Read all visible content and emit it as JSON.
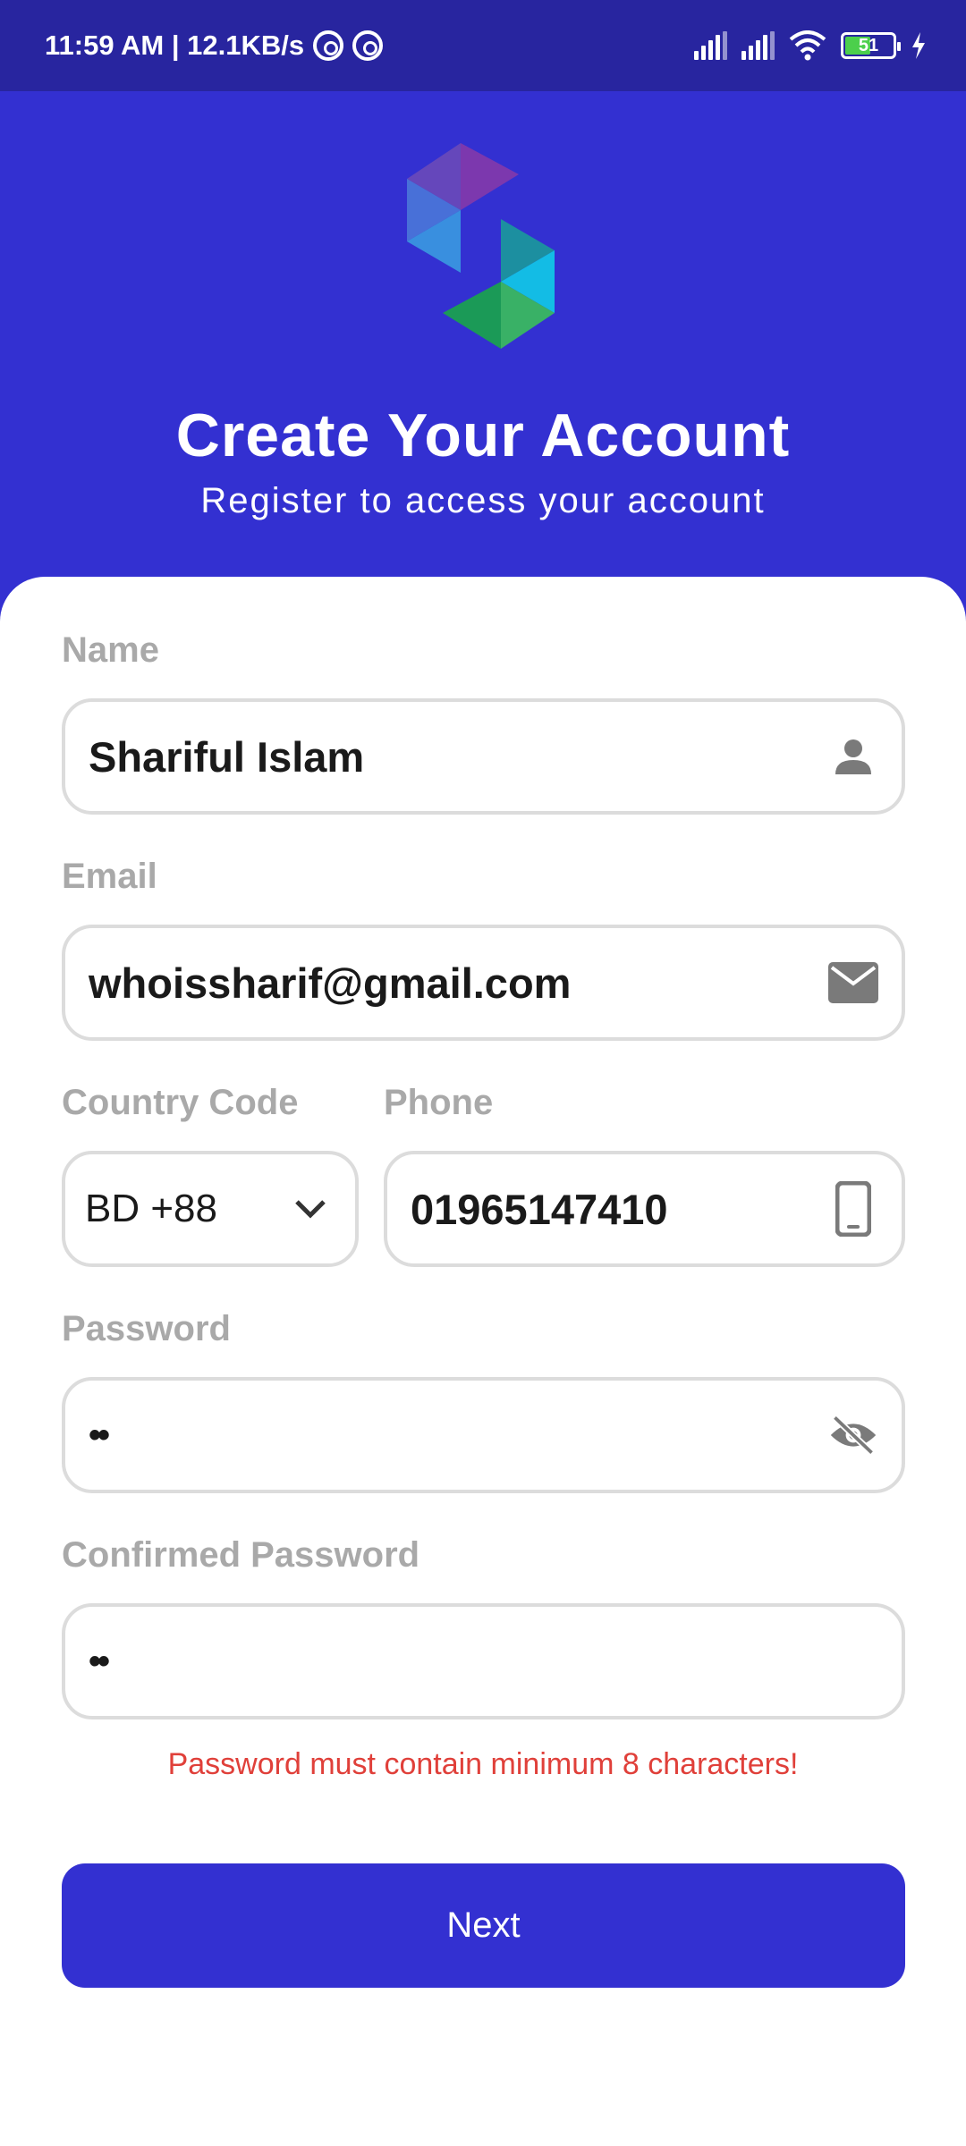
{
  "status_bar": {
    "time_speed": "11:59 AM | 12.1KB/s",
    "battery": "51"
  },
  "header": {
    "title": "Create Your Account",
    "subtitle": "Register to access your account"
  },
  "form": {
    "name": {
      "label": "Name",
      "value": "Shariful Islam",
      "icon": "person-icon"
    },
    "email": {
      "label": "Email",
      "value": "whoissharif@gmail.com",
      "icon": "mail-icon"
    },
    "country_code": {
      "label": "Country Code",
      "value": "BD +88",
      "icon": "chevron-down-icon"
    },
    "phone": {
      "label": "Phone",
      "value": "01965147410",
      "icon": "phone-icon"
    },
    "password": {
      "label": "Password",
      "value": "••",
      "icon": "eye-off-icon"
    },
    "confirm_password": {
      "label": "Confirmed Password",
      "value": "••"
    },
    "error": "Password must contain minimum 8 characters!"
  },
  "actions": {
    "next_label": "Next"
  },
  "colors": {
    "primary": "#3330d1",
    "status_bar": "#28259f",
    "error": "#e0403a",
    "label": "#a9a9a9"
  }
}
